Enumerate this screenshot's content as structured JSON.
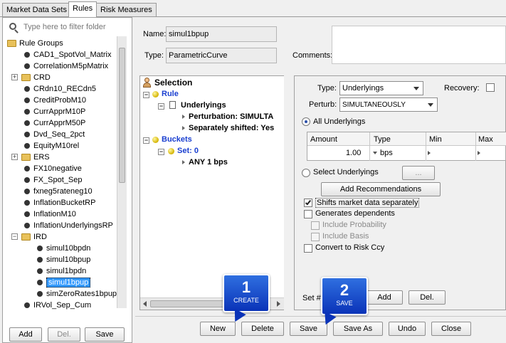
{
  "tabs": [
    "Market Data Sets",
    "Rules",
    "Risk Measures"
  ],
  "filter": {
    "placeholder": "Type here to filter folder"
  },
  "tree": {
    "root": "Rule Groups",
    "items": [
      {
        "label": "CAD1_SpotVol_Matrix",
        "kind": "leaf"
      },
      {
        "label": "CorrelationM5pMatrix",
        "kind": "leaf"
      },
      {
        "label": "CRD",
        "kind": "folder"
      },
      {
        "label": "CRdn10_RECdn5",
        "kind": "leaf"
      },
      {
        "label": "CreditProbM10",
        "kind": "leaf"
      },
      {
        "label": "CurrApprM10P",
        "kind": "leaf"
      },
      {
        "label": "CurrApprM50P",
        "kind": "leaf"
      },
      {
        "label": "Dvd_Seq_2pct",
        "kind": "leaf"
      },
      {
        "label": "EquityM10rel",
        "kind": "leaf"
      },
      {
        "label": "ERS",
        "kind": "folder"
      },
      {
        "label": "FX10negative",
        "kind": "leaf"
      },
      {
        "label": "FX_Spot_Sep",
        "kind": "leaf"
      },
      {
        "label": "fxneg5rateneg10",
        "kind": "leaf"
      },
      {
        "label": "InflationBucketRP",
        "kind": "leaf"
      },
      {
        "label": "InflationM10",
        "kind": "leaf"
      },
      {
        "label": "InflationUnderlyingsRP",
        "kind": "leaf"
      },
      {
        "label": "IRD",
        "kind": "folder-open"
      },
      {
        "label": "simul10bpdn",
        "kind": "child"
      },
      {
        "label": "simul10bpup",
        "kind": "child"
      },
      {
        "label": "simul1bpdn",
        "kind": "child"
      },
      {
        "label": "simul1bpup",
        "kind": "child-selected"
      },
      {
        "label": "simZeroRates1bpup",
        "kind": "child"
      },
      {
        "label": "IRVol_Sep_Cum",
        "kind": "leaf"
      }
    ]
  },
  "left_buttons": {
    "add": "Add",
    "del": "Del.",
    "save": "Save"
  },
  "form": {
    "name_label": "Name:",
    "name_value": "simul1bpup",
    "type_label": "Type:",
    "type_value": "ParametricCurve",
    "comments_label": "Comments:"
  },
  "rule_tree": {
    "selection": "Selection",
    "rule": "Rule",
    "underlyings": "Underlyings",
    "perturbation": "Perturbation:  SIMULTA",
    "separately": "Separately shifted: Yes",
    "buckets": "Buckets",
    "set": "Set: 0",
    "any": "ANY 1 bps"
  },
  "details": {
    "type_label": "Type:",
    "type_value": "Underlyings",
    "recovery_label": "Recovery:",
    "perturb_label": "Perturb:",
    "perturb_value": "SIMULTANEOUSLY",
    "all_underlyings": "All Underlyings",
    "columns": [
      "Amount",
      "Type",
      "Min",
      "Max"
    ],
    "row": {
      "amount": "1.00",
      "type": "bps",
      "min": "",
      "max": ""
    },
    "select_underlyings": "Select Underlyings",
    "ellipsis": "...",
    "add_recommendations": "Add Recommendations",
    "shifts": "Shifts market data separately",
    "generates": "Generates dependents",
    "include_probability": "Include Probability",
    "include_basis": "Include Basis",
    "convert": "Convert to Risk Ccy",
    "set_label": "Set #",
    "add": "Add",
    "del": "Del."
  },
  "bottom_buttons": {
    "new": "New",
    "delete": "Delete",
    "save": "Save",
    "save_as": "Save As",
    "undo": "Undo",
    "close": "Close"
  },
  "callouts": [
    {
      "num": "1",
      "cap": "CREATE"
    },
    {
      "num": "2",
      "cap": "SAVE"
    }
  ],
  "colors": {
    "accent_blue": "#1a3fd0",
    "selection": "#3399ff"
  }
}
